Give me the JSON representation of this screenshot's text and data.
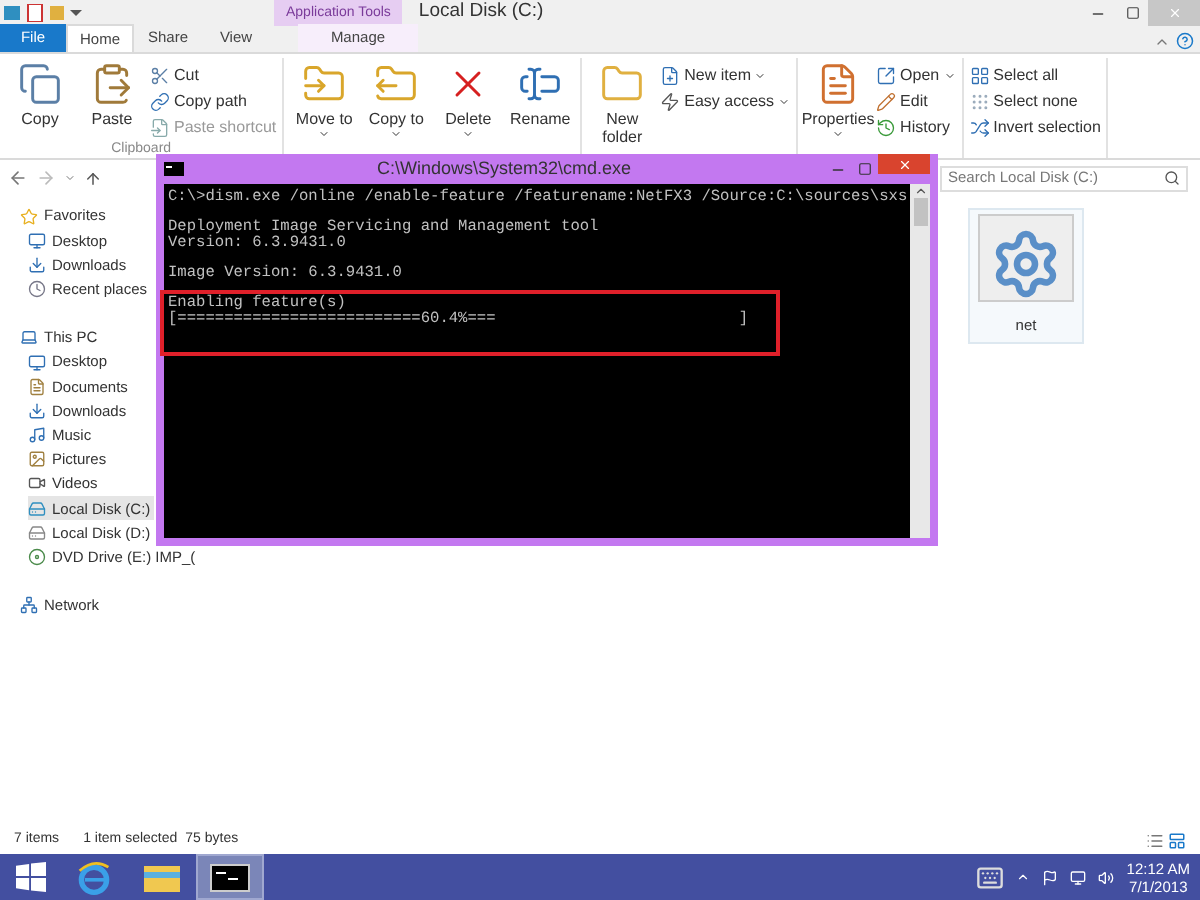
{
  "explorer": {
    "context_group": "Application Tools",
    "title": "Local Disk (C:)",
    "ribbon_tabs": [
      {
        "label": "File",
        "kind": "file",
        "selected": false
      },
      {
        "label": "Home",
        "kind": "tab",
        "selected": true
      },
      {
        "label": "Share",
        "kind": "tab",
        "selected": false
      },
      {
        "label": "View",
        "kind": "tab",
        "selected": false
      },
      {
        "label": "Manage",
        "kind": "context",
        "selected": false
      }
    ],
    "ribbon_groups": [
      {
        "label": "Clipboard",
        "items": [
          {
            "kind": "large",
            "label": "Copy",
            "dropdown": false
          },
          {
            "kind": "large",
            "label": "Paste",
            "dropdown": false
          },
          {
            "kind": "small",
            "label": "Cut",
            "disabled": false
          },
          {
            "kind": "small",
            "label": "Copy path",
            "disabled": false
          },
          {
            "kind": "small",
            "label": "Paste shortcut",
            "disabled": true
          }
        ]
      },
      {
        "items": [
          {
            "kind": "large",
            "label": "Move to",
            "dropdown": true
          },
          {
            "kind": "large",
            "label": "Copy to",
            "dropdown": true
          },
          {
            "kind": "large",
            "label": "Delete",
            "dropdown": true
          },
          {
            "kind": "large",
            "label": "Rename",
            "dropdown": false
          }
        ]
      },
      {
        "items": [
          {
            "kind": "large",
            "label": "New folder",
            "dropdown": false
          },
          {
            "kind": "small",
            "label": "New item",
            "dropdown": true,
            "disabled": false
          },
          {
            "kind": "small",
            "label": "Easy access",
            "dropdown": true,
            "disabled": false
          }
        ]
      },
      {
        "items": [
          {
            "kind": "large",
            "label": "Properties",
            "dropdown": true
          },
          {
            "kind": "small",
            "label": "Open",
            "dropdown": true,
            "disabled": false
          },
          {
            "kind": "small",
            "label": "Edit",
            "disabled": false
          },
          {
            "kind": "small",
            "label": "History",
            "disabled": false
          }
        ]
      },
      {
        "items": [
          {
            "kind": "small",
            "label": "Select all",
            "disabled": false
          },
          {
            "kind": "small",
            "label": "Select none",
            "disabled": false
          },
          {
            "kind": "small",
            "label": "Invert selection",
            "disabled": false
          }
        ]
      }
    ],
    "search": {
      "placeholder": "Search Local Disk (C:)"
    },
    "nav": [
      {
        "label": "Favorites",
        "selected": false,
        "children": [
          {
            "label": "Desktop",
            "selected": false
          },
          {
            "label": "Downloads",
            "selected": false
          },
          {
            "label": "Recent places",
            "selected": false
          }
        ]
      },
      {
        "label": "This PC",
        "selected": false,
        "children": [
          {
            "label": "Desktop",
            "selected": false
          },
          {
            "label": "Documents",
            "selected": false
          },
          {
            "label": "Downloads",
            "selected": false
          },
          {
            "label": "Music",
            "selected": false
          },
          {
            "label": "Pictures",
            "selected": false
          },
          {
            "label": "Videos",
            "selected": false
          },
          {
            "label": "Local Disk (C:)",
            "selected": true
          },
          {
            "label": "Local Disk (D:)",
            "selected": false
          },
          {
            "label": "DVD Drive (E:) IMP_(",
            "selected": false
          }
        ]
      },
      {
        "label": "Network",
        "selected": false
      }
    ],
    "files": [
      {
        "name": "net",
        "selected": true
      }
    ],
    "status": {
      "count": "7 items",
      "selection": "1 item selected",
      "size": "75 bytes"
    }
  },
  "console": {
    "title": "C:\\Windows\\System32\\cmd.exe",
    "blocks": [
      {
        "highlighted": false,
        "lines": [
          "C:\\>dism.exe /online /enable-feature /featurename:NetFX3 /Source:C:\\sources\\sxs"
        ]
      },
      {
        "highlighted": false,
        "lines": [
          "Deployment Image Servicing and Management tool",
          "Version: 6.3.9431.0"
        ]
      },
      {
        "highlighted": false,
        "lines": [
          "Image Version: 6.3.9431.0"
        ]
      },
      {
        "highlighted": true,
        "lines": [
          "Enabling feature(s)",
          "[==========================60.4%===                          ]"
        ]
      }
    ]
  },
  "taskbar": {
    "apps": [
      {
        "active": false
      },
      {
        "active": false
      },
      {
        "active": true
      }
    ],
    "time": "12:12 AM",
    "date": "7/1/2013"
  }
}
